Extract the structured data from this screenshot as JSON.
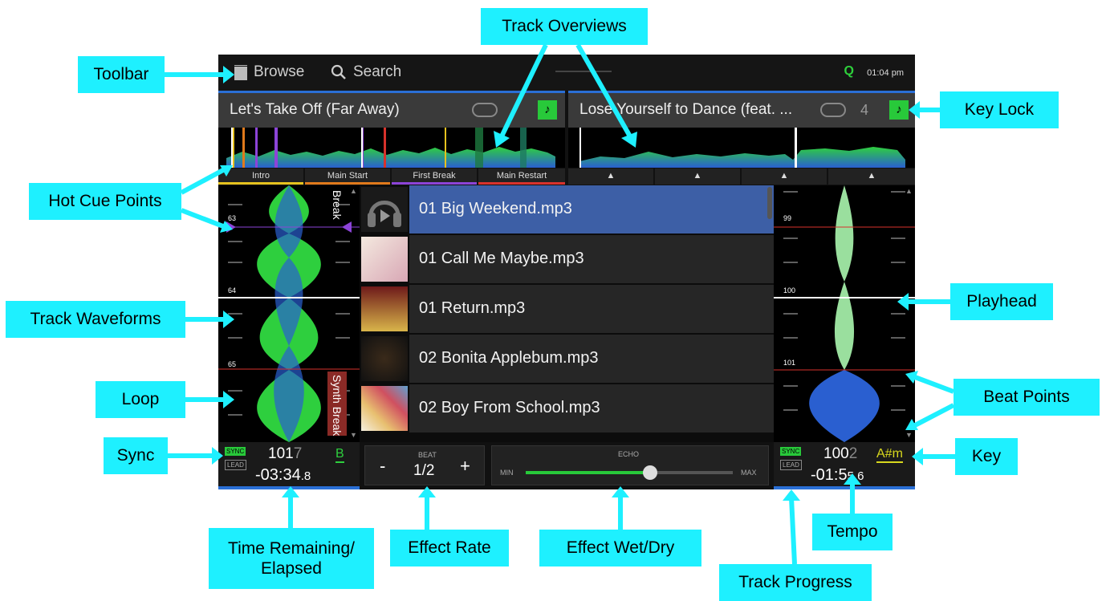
{
  "toolbar": {
    "browse_label": "Browse",
    "search_label": "Search",
    "quantize_icon": "Q",
    "clock": "01:04 pm"
  },
  "deck_left": {
    "title": "Let's Take Off (Far Away)",
    "hot_cues": [
      "Intro",
      "Main Start",
      "First Break",
      "Main Restart"
    ],
    "hot_cue_colors": [
      "#e6c21e",
      "#e07a1c",
      "#8c44d8",
      "#d8322c"
    ],
    "waveform_markers": [
      "63",
      "64",
      "65"
    ],
    "section_labels": [
      "Break",
      "Synth Break"
    ],
    "sync_label": "SYNC",
    "lead_label": "LEAD",
    "tempo_main": "101",
    "tempo_dim": "7",
    "key": "B",
    "time_remaining": "-03:34",
    "time_fraction": ".8"
  },
  "deck_right": {
    "title": "Lose Yourself to Dance (feat. ...",
    "loop_count": "4",
    "hot_cues": [
      "▲",
      "▲",
      "▲",
      "▲"
    ],
    "waveform_markers": [
      "99",
      "100",
      "101"
    ],
    "sync_label": "SYNC",
    "lead_label": "LEAD",
    "tempo_main": "100",
    "tempo_dim": "2",
    "key": "A#m",
    "time_remaining": "-01:5",
    "time_fraction": "5.6"
  },
  "tracks": [
    {
      "name": "01 Big Weekend.mp3",
      "selected": true
    },
    {
      "name": "01 Call Me Maybe.mp3",
      "selected": false
    },
    {
      "name": "01 Return.mp3",
      "selected": false
    },
    {
      "name": "02 Bonita Applebum.mp3",
      "selected": false
    },
    {
      "name": "02 Boy From School.mp3",
      "selected": false
    }
  ],
  "effects": {
    "beat_label": "BEAT",
    "beat_value": "1/2",
    "minus": "-",
    "plus": "+",
    "fx_name": "ECHO",
    "min_label": "MIN",
    "max_label": "MAX",
    "wet_dry_level": 0.6
  },
  "callouts": {
    "toolbar": "Toolbar",
    "track_overviews": "Track Overviews",
    "key_lock": "Key Lock",
    "hot_cue_points": "Hot Cue Points",
    "track_waveforms": "Track Waveforms",
    "playhead": "Playhead",
    "loop": "Loop",
    "beat_points": "Beat Points",
    "sync": "Sync",
    "key": "Key",
    "time_remaining_line1": "Time Remaining/",
    "time_remaining_line2": "Elapsed",
    "effect_rate": "Effect Rate",
    "effect_wet_dry": "Effect Wet/Dry",
    "tempo": "Tempo",
    "track_progress": "Track Progress"
  },
  "colors": {
    "callout": "#1ef0ff",
    "accent_green": "#28c93a",
    "accent_blue": "#2a6fd6",
    "selected_row": "#3d5fa6"
  }
}
